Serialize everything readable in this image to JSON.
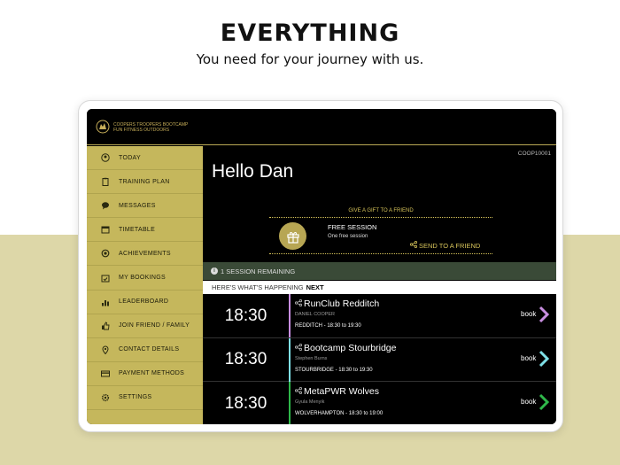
{
  "hero": {
    "title": "EVERYTHING",
    "subtitle": "You need for your journey with us."
  },
  "app": {
    "logo_line1": "COOPERS TROOPERS BOOTCAMP",
    "logo_line2": "FUN FITNESS OUTDOORS",
    "member_code": "COOP10001",
    "greeting": "Hello Dan"
  },
  "sidebar": {
    "items": [
      {
        "label": "TODAY",
        "icon": "user-circle-icon"
      },
      {
        "label": "TRAINING PLAN",
        "icon": "clipboard-icon"
      },
      {
        "label": "MESSAGES",
        "icon": "chat-bubble-icon"
      },
      {
        "label": "TIMETABLE",
        "icon": "calendar-icon"
      },
      {
        "label": "ACHIEVEMENTS",
        "icon": "medal-icon"
      },
      {
        "label": "MY BOOKINGS",
        "icon": "calendar-check-icon"
      },
      {
        "label": "LEADERBOARD",
        "icon": "bar-chart-icon"
      },
      {
        "label": "JOIN FRIEND / FAMILY",
        "icon": "thumbs-up-icon"
      },
      {
        "label": "CONTACT DETAILS",
        "icon": "location-pin-icon"
      },
      {
        "label": "PAYMENT METHODS",
        "icon": "credit-card-icon"
      },
      {
        "label": "SETTINGS",
        "icon": "gear-icon"
      }
    ]
  },
  "gift": {
    "label": "GIVE A GIFT TO A FRIEND",
    "title": "FREE SESSION",
    "subtitle": "One free session",
    "send_label": "SEND TO A FRIEND"
  },
  "remaining": {
    "text": "1 SESSION REMAINING"
  },
  "happening": {
    "prefix": "HERE'S WHAT'S HAPPENING",
    "suffix": "NEXT"
  },
  "sessions": [
    {
      "time": "18:30",
      "name": "RunClub Redditch",
      "coach": "DANIEL COOPER",
      "location": "REDDITCH - 18:30 to 19:30",
      "book": "book",
      "color": "#c88ee0"
    },
    {
      "time": "18:30",
      "name": "Bootcamp Stourbridge",
      "coach": "Stephen Burns",
      "location": "STOURBRIDGE - 18:30 to 19:30",
      "book": "book",
      "color": "#7fe0e8"
    },
    {
      "time": "18:30",
      "name": "MetaPWR Wolves",
      "coach": "Gyula Menyik",
      "location": "WOLVERHAMPTON - 18:30 to 19:00",
      "book": "book",
      "color": "#2fb84a"
    }
  ],
  "colors": {
    "accent_gold": "#c5b75c",
    "band": "#ddd7a8",
    "remaining_bg": "#3a4a37"
  }
}
